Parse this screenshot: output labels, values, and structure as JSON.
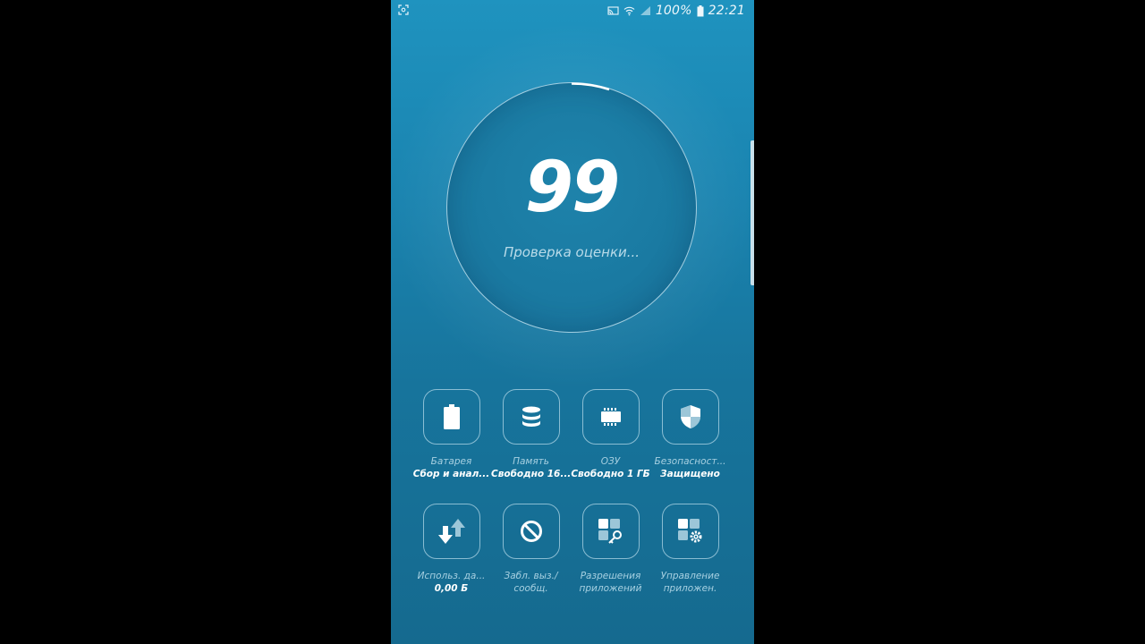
{
  "status_bar": {
    "battery_percent": "100%",
    "time": "22:21",
    "icons": [
      "screenshot-icon",
      "cast-icon",
      "wifi-icon",
      "signal-icon",
      "battery-icon"
    ]
  },
  "score": {
    "value": "99",
    "caption": "Проверка оценки..."
  },
  "tiles_row1": [
    {
      "icon": "battery-icon",
      "label": "Батарея",
      "value": "Сбор и анал..."
    },
    {
      "icon": "storage-icon",
      "label": "Память",
      "value": "Свободно 16..."
    },
    {
      "icon": "ram-chip-icon",
      "label": "ОЗУ",
      "value": "Свободно 1 ГБ"
    },
    {
      "icon": "shield-icon",
      "label": "Безопасност...",
      "value": "Защищено"
    }
  ],
  "tiles_row2": [
    {
      "icon": "data-usage-icon",
      "label": "Использ. да...",
      "value": "0,00 Б"
    },
    {
      "icon": "block-icon",
      "label": "Забл. выз./",
      "label2": "сообщ."
    },
    {
      "icon": "app-permissions-icon",
      "label": "Разрешения",
      "label2": "приложений"
    },
    {
      "icon": "app-settings-icon",
      "label": "Управление",
      "label2": "приложен."
    }
  ],
  "colors": {
    "background_top": "#1f93bf",
    "background_bottom": "#156a8f",
    "accent_text": "#ffffff",
    "muted_text": "#a7d0e1"
  }
}
